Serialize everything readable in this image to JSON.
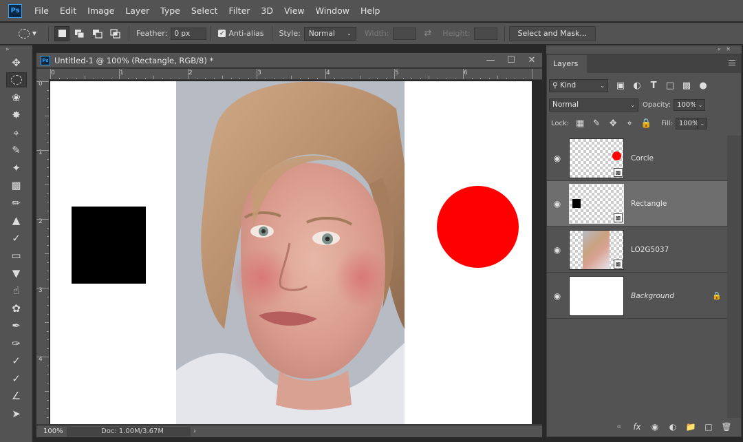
{
  "app": {
    "logo": "Ps"
  },
  "menu": [
    "File",
    "Edit",
    "Image",
    "Layer",
    "Type",
    "Select",
    "Filter",
    "3D",
    "View",
    "Window",
    "Help"
  ],
  "options": {
    "feather_label": "Feather:",
    "feather_value": "0 px",
    "antialias_label": "Anti-alias",
    "antialias_checked": true,
    "style_label": "Style:",
    "style_value": "Normal",
    "width_label": "Width:",
    "height_label": "Height:",
    "select_mask_label": "Select and Mask..."
  },
  "tools": [
    "move-icon",
    "elliptical-marquee-icon",
    "lasso-icon",
    "magic-wand-icon",
    "crop-icon",
    "eyedropper-icon",
    "spot-healing-icon",
    "bandage-icon",
    "brush-icon",
    "stamp-icon",
    "history-brush-icon",
    "eraser-icon",
    "paint-bucket-icon",
    "smudge-icon",
    "sponge-icon",
    "pen-icon",
    "freeform-pen-icon",
    "add-anchor-icon",
    "delete-anchor-icon",
    "convert-point-icon",
    "path-selection-icon"
  ],
  "document": {
    "title": "Untitled-1 @ 100% (Rectangle, RGB/8) *",
    "zoom": "100%",
    "doc_info": "Doc: 1.00M/3.67M",
    "ruler_h": [
      "0",
      "1",
      "2",
      "3",
      "4",
      "5",
      "6"
    ],
    "ruler_v": [
      "0",
      "1",
      "2",
      "3",
      "4"
    ],
    "shapes": {
      "rectangle_color": "#000000",
      "circle_color": "#ff0000"
    }
  },
  "layers_panel": {
    "tab": "Layers",
    "filter_kind": "Kind",
    "blend_mode": "Normal",
    "opacity_label": "Opacity:",
    "opacity_value": "100%",
    "lock_label": "Lock:",
    "fill_label": "Fill:",
    "fill_value": "100%",
    "layers": [
      {
        "name": "Corcle",
        "visible": true,
        "selected": false
      },
      {
        "name": "Rectangle",
        "visible": true,
        "selected": true
      },
      {
        "name": "LO2G5037",
        "visible": true,
        "selected": false
      },
      {
        "name": "Background",
        "visible": true,
        "selected": false,
        "locked": true
      }
    ]
  }
}
